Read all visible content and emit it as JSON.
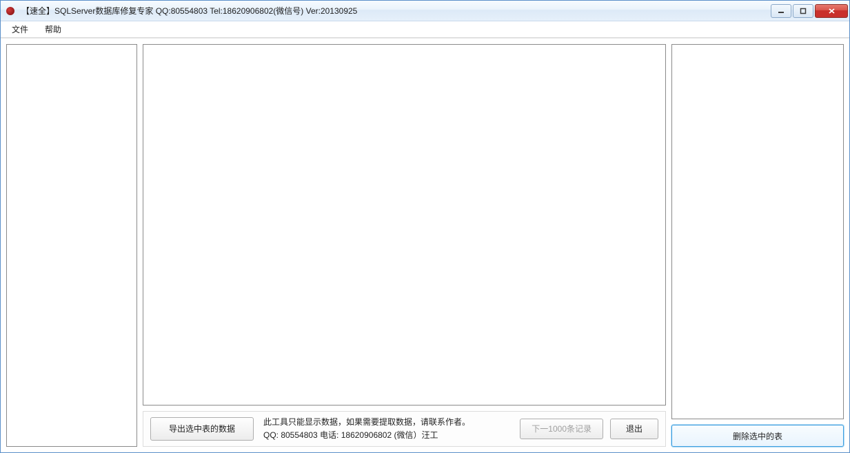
{
  "window": {
    "title": "【速全】SQLServer数据库修复专家    QQ:80554803 Tel:18620906802(微信号)  Ver:20130925"
  },
  "menu": {
    "file": "文件",
    "help": "帮助"
  },
  "right": {
    "delete_selected_table": "删除选中的表"
  },
  "bottom": {
    "export_selected_data": "导出选中表的数据",
    "info_line1": "此工具只能显示数据，如果需要提取数据，请联系作者。",
    "info_line2": "QQ: 80554803    电话: 18620906802 (微信）汪工",
    "next_records": "下一1000条记录",
    "exit": "退出"
  }
}
